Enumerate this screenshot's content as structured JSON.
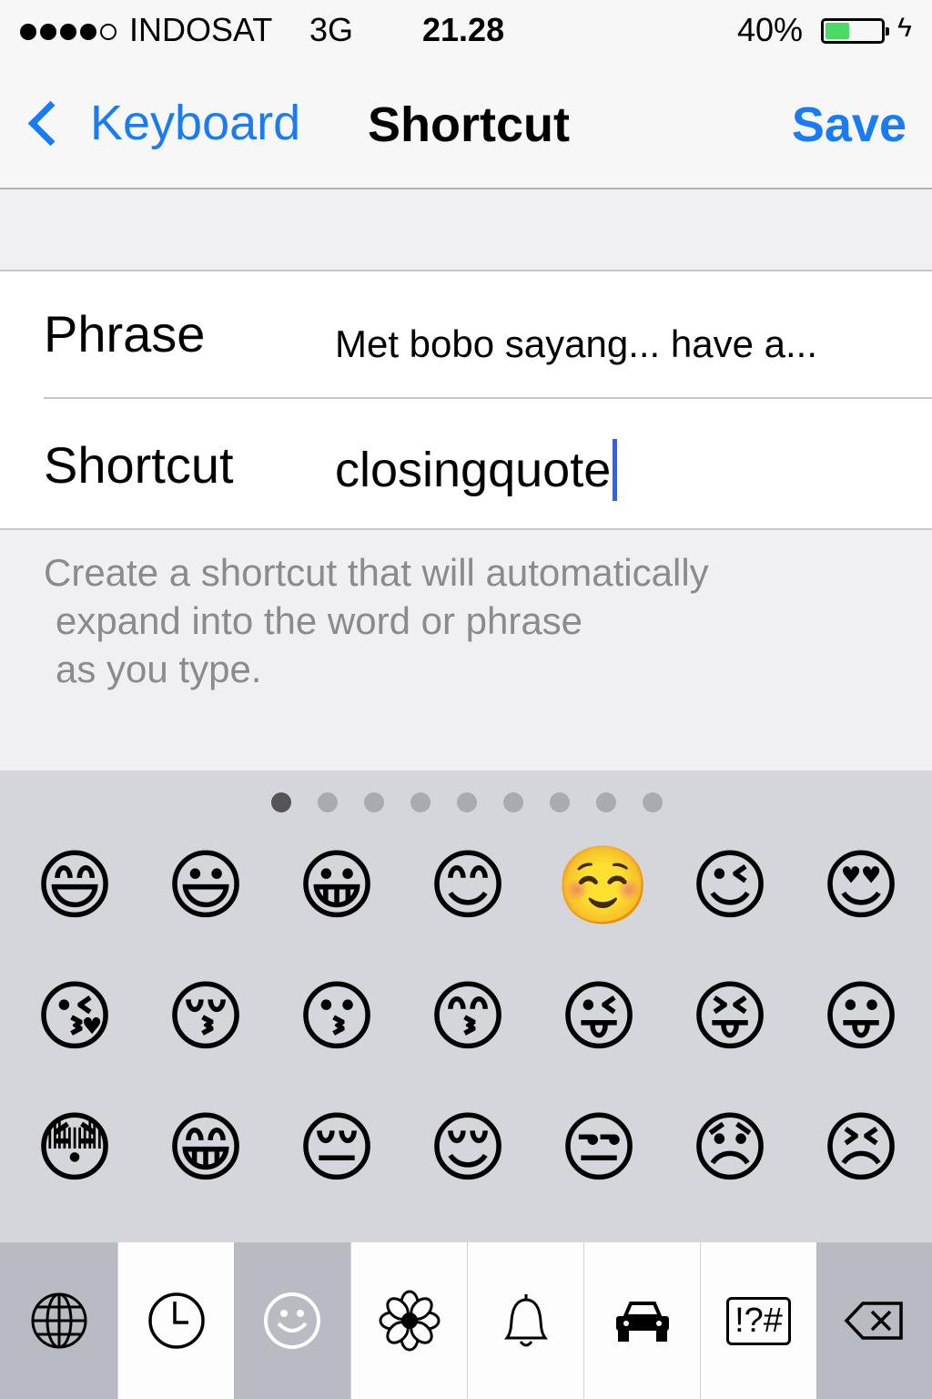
{
  "status_bar": {
    "signal_bars": 5,
    "signal_filled": 4,
    "carrier": "INDOSAT",
    "network": "3G",
    "time": "21.28",
    "battery_percent": "40%",
    "battery_level": 0.4,
    "charging": true
  },
  "nav": {
    "back_label": "Keyboard",
    "title": "Shortcut",
    "save_label": "Save",
    "accent_color": "#1a7cf4"
  },
  "form": {
    "phrase_label": "Phrase",
    "phrase_value": "Met bobo sayang... have a...",
    "shortcut_label": "Shortcut",
    "shortcut_value": "closingquote"
  },
  "footer": {
    "line1": "Create a shortcut that will automatically",
    "line2": "expand into the word or phrase",
    "line3": "as you type."
  },
  "emoji_keyboard": {
    "page_count": 9,
    "active_page": 1,
    "rows": [
      [
        "😄",
        "😃",
        "😀",
        "😊",
        "☺️",
        "😉",
        "😍"
      ],
      [
        "😘",
        "😚",
        "😗",
        "😙",
        "😜",
        "😝",
        "😛"
      ],
      [
        "😳",
        "😁",
        "😔",
        "😌",
        "😒",
        "😞",
        "😣"
      ]
    ],
    "tabs": [
      {
        "icon": "globe-icon",
        "active": false
      },
      {
        "icon": "clock-icon",
        "active": false
      },
      {
        "icon": "smiley-icon",
        "active": true
      },
      {
        "icon": "flower-icon",
        "active": false
      },
      {
        "icon": "bell-icon",
        "active": false
      },
      {
        "icon": "car-icon",
        "active": false
      },
      {
        "icon": "symbols-icon",
        "label": "!?#",
        "active": false
      },
      {
        "icon": "backspace-icon",
        "active": false
      }
    ]
  }
}
